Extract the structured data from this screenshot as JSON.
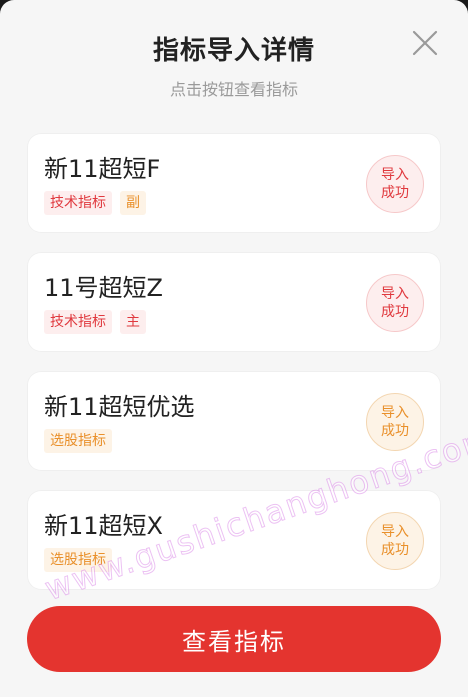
{
  "header": {
    "title": "指标导入详情",
    "subtitle": "点击按钮查看指标",
    "close_icon": "close-icon"
  },
  "items": [
    {
      "name": "新11超短F",
      "tags": [
        {
          "label": "技术指标",
          "color": "#e0393e"
        },
        {
          "label": "副",
          "color": "#e9902b"
        }
      ],
      "badge_line1": "导入",
      "badge_line2": "成功",
      "badge_color": "#e0393e"
    },
    {
      "name": "11号超短Z",
      "tags": [
        {
          "label": "技术指标",
          "color": "#e0393e"
        },
        {
          "label": "主",
          "color": "#e0393e"
        }
      ],
      "badge_line1": "导入",
      "badge_line2": "成功",
      "badge_color": "#e0393e"
    },
    {
      "name": "新11超短优选",
      "tags": [
        {
          "label": "选股指标",
          "color": "#e9902b"
        }
      ],
      "badge_line1": "导入",
      "badge_line2": "成功",
      "badge_color": "#e9902b"
    },
    {
      "name": "新11超短X",
      "tags": [
        {
          "label": "选股指标",
          "color": "#e9902b"
        }
      ],
      "badge_line1": "导入",
      "badge_line2": "成功",
      "badge_color": "#e9902b"
    }
  ],
  "footer": {
    "view_button_label": "查看指标",
    "accent_color": "#e4342f"
  },
  "watermark": "www.gushichanghong.com"
}
